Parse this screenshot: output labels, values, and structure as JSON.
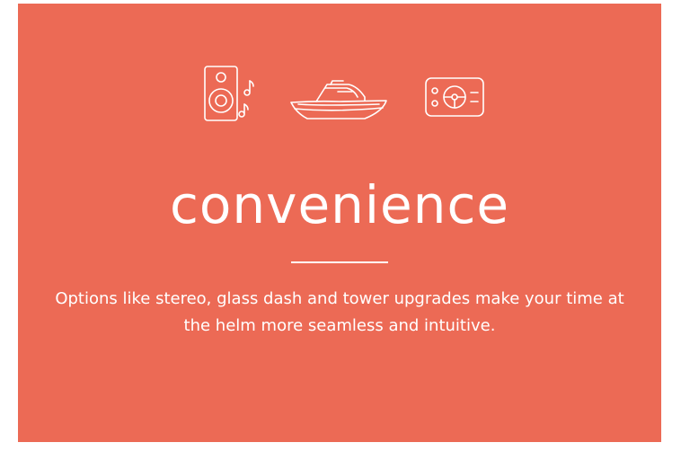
{
  "section": {
    "title": "convenience",
    "description": "Options like stereo, glass dash and tower upgrades make your time at the helm more seamless and intuitive."
  },
  "icons": [
    "speaker-icon",
    "boat-icon",
    "dashboard-icon"
  ],
  "colors": {
    "panel_background": "#ec6a55",
    "text": "#ffffff"
  }
}
